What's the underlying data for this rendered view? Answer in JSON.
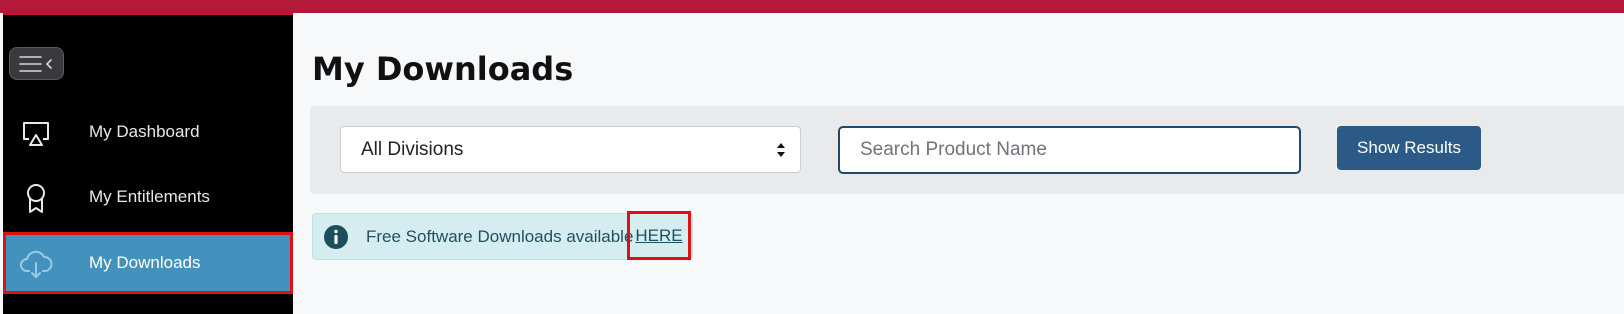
{
  "colors": {
    "topbar": "#b5193a",
    "sidebar_bg": "#000000",
    "active_item_bg": "#4392be",
    "primary_button": "#2b5a86",
    "alert_bg": "#d5ecf1",
    "highlight_box": "#e01010"
  },
  "sidebar": {
    "toggle_icon": "hamburger-collapse-icon",
    "items": [
      {
        "label": "My Dashboard",
        "icon": "dashboard-icon",
        "active": false
      },
      {
        "label": "My Entitlements",
        "icon": "award-ribbon-icon",
        "active": false
      },
      {
        "label": "My Downloads",
        "icon": "cloud-download-icon",
        "active": true
      }
    ]
  },
  "main": {
    "title": "My Downloads",
    "filters": {
      "division_selected": "All Divisions",
      "search_placeholder": "Search Product Name",
      "search_value": "",
      "submit_label": "Show Results"
    },
    "alert": {
      "icon": "info-icon",
      "message": "Free Software Downloads available",
      "link_label": "HERE"
    }
  }
}
